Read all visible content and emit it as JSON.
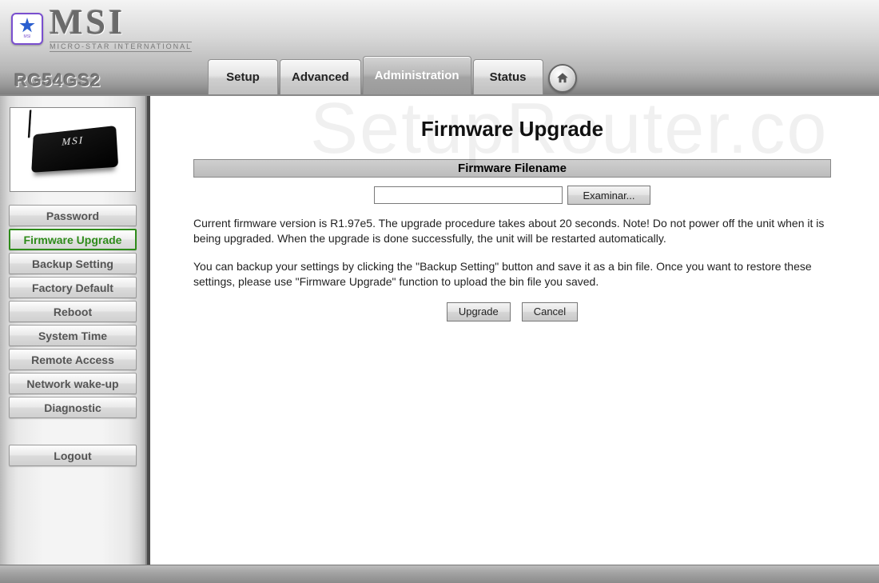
{
  "brand": {
    "main": "MSI",
    "sub": "MICRO-STAR INTERNATIONAL",
    "badge": "MSI"
  },
  "model": "RG54GS2",
  "topnav": {
    "items": [
      {
        "label": "Setup"
      },
      {
        "label": "Advanced"
      },
      {
        "label": "Administration"
      },
      {
        "label": "Status"
      }
    ],
    "active_index": 2
  },
  "sidebar": {
    "device_label": "MSI",
    "items": [
      {
        "label": "Password"
      },
      {
        "label": "Firmware Upgrade"
      },
      {
        "label": "Backup Setting"
      },
      {
        "label": "Factory Default"
      },
      {
        "label": "Reboot"
      },
      {
        "label": "System Time"
      },
      {
        "label": "Remote Access"
      },
      {
        "label": "Network wake-up"
      },
      {
        "label": "Diagnostic"
      }
    ],
    "active_index": 1,
    "logout_label": "Logout"
  },
  "content": {
    "watermark": "SetupRouter.co",
    "page_title": "Firmware Upgrade",
    "section_header": "Firmware Filename",
    "file_value": "",
    "browse_label": "Examinar...",
    "paragraph1": "Current firmware version is R1.97e5. The upgrade procedure takes about 20 seconds. Note! Do not power off the unit when it is being upgraded. When the upgrade is done successfully, the unit will be restarted automatically.",
    "paragraph2": "You can backup your settings by clicking the \"Backup Setting\" button and save it as a bin file. Once you want to restore these settings, please use \"Firmware Upgrade\" function to upload the bin file you saved.",
    "upgrade_label": "Upgrade",
    "cancel_label": "Cancel"
  }
}
